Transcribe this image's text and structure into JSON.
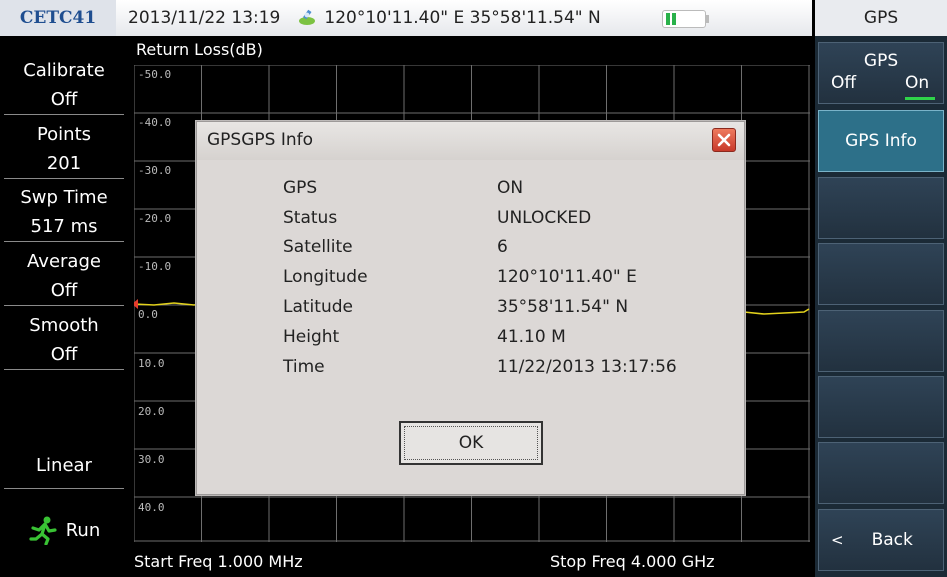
{
  "status_bar": {
    "brand": "CETC41",
    "datetime": "2013/11/22  13:19",
    "coordinates": "120°10'11.40\" E 35°58'11.54\" N",
    "icons": [
      "gps-satellite-icon",
      "battery-icon"
    ]
  },
  "left_menu": {
    "items": [
      {
        "label": "Calibrate",
        "value": "Off"
      },
      {
        "label": "Points",
        "value": "201"
      },
      {
        "label": "Swp Time",
        "value": "517 ms"
      },
      {
        "label": "Average",
        "value": "Off"
      },
      {
        "label": "Smooth",
        "value": "Off"
      }
    ],
    "scale": "Linear",
    "run_label": "Run"
  },
  "plot": {
    "title": "Return Loss(dB)",
    "ticks": [
      "-50.0",
      "-40.0",
      "-30.0",
      "-20.0",
      "-10.0",
      "0.0",
      "10.0",
      "20.0",
      "30.0",
      "40.0"
    ],
    "start_freq": "Start Freq 1.000 MHz",
    "stop_freq": "Stop Freq 4.000 GHz",
    "trace_color": "#e3d21c",
    "marker_color": "#e53b2c"
  },
  "right_menu": {
    "title": "GPS",
    "gps_key": {
      "label": "GPS",
      "off": "Off",
      "on": "On"
    },
    "info_key": "GPS Info",
    "back_key": "Back",
    "accent": "#2d7089"
  },
  "dialog": {
    "title": "GPSGPS Info",
    "rows": [
      {
        "key": "GPS",
        "value": "ON"
      },
      {
        "key": "Status",
        "value": "UNLOCKED"
      },
      {
        "key": "Satellite",
        "value": "6"
      },
      {
        "key": "Longitude",
        "value": "120°10'11.40\" E"
      },
      {
        "key": "Latitude",
        "value": "35°58'11.54\" N"
      },
      {
        "key": "Height",
        "value": "41.10 M"
      },
      {
        "key": "Time",
        "value": "11/22/2013 13:17:56"
      }
    ],
    "ok_label": "OK"
  }
}
